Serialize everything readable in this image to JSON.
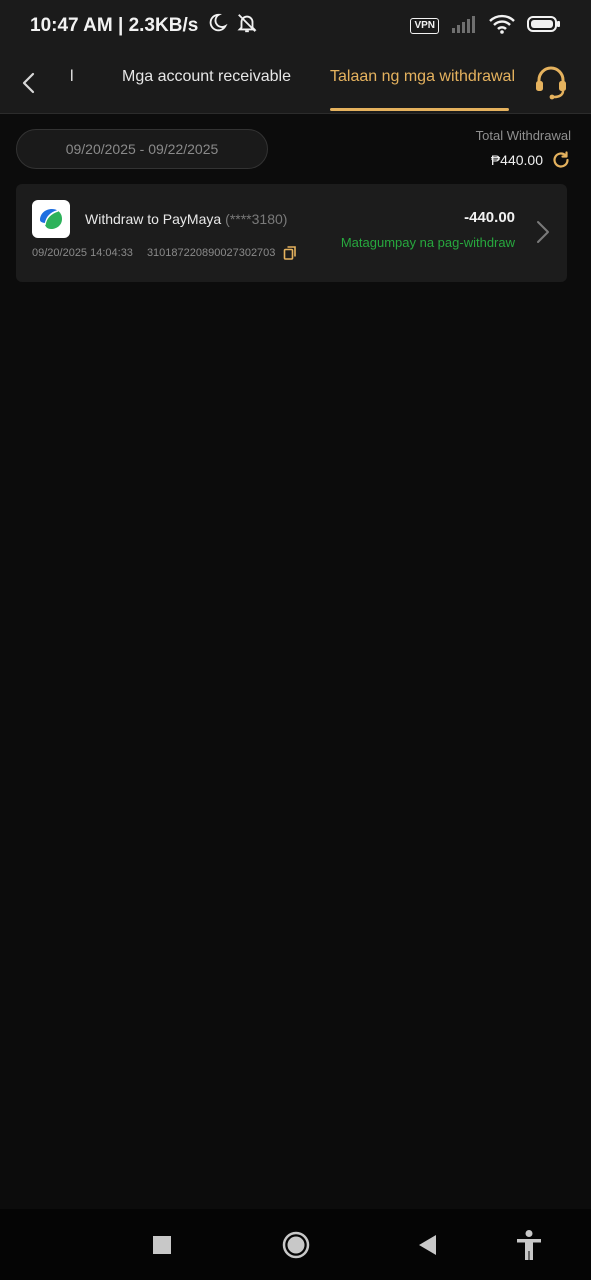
{
  "status_bar": {
    "time_speed": "10:47 AM | 2.3KB/s",
    "vpn": "VPN"
  },
  "header": {
    "tab_partial": "l",
    "tab_receivable": "Mga account receivable",
    "tab_withdrawal": "Talaan ng mga withdrawal"
  },
  "filter": {
    "date_range": "09/20/2025 - 09/22/2025",
    "total_label": "Total Withdrawal",
    "total_amount": "₱440.00"
  },
  "records": [
    {
      "title": "Withdraw to PayMaya",
      "account": "(****3180)",
      "datetime": "09/20/2025 14:04:33",
      "order_id": "310187220890027302703",
      "amount": "-440.00",
      "status": "Matagumpay na pag-withdraw"
    }
  ],
  "colors": {
    "accent": "#e5b25e",
    "success": "#27a83e",
    "background": "#0c0c0c",
    "card": "#1c1c1c"
  }
}
